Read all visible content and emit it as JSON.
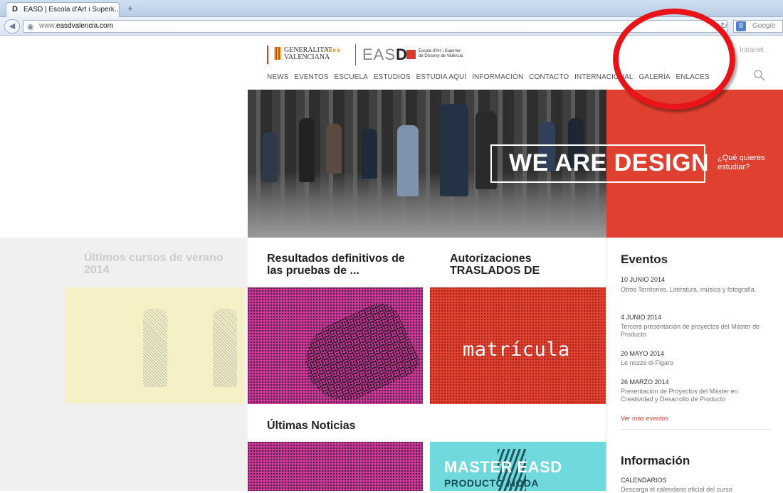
{
  "browser": {
    "tab_title": "EASD | Escola d'Art i Superi...",
    "tab_favicon": "D",
    "tab_close": "×",
    "new_tab": "+",
    "url_prefix": "www.",
    "url_domain": "easdvalencia.com",
    "search_placeholder": "Google",
    "search_engine_icon": "8"
  },
  "header": {
    "gv_logo_text": "GENERALITAT\nVALENCIANA",
    "iseacv_logo": "isea",
    "easd_logo_a": "EAS",
    "easd_logo_b": "D",
    "easd_subtitle_1": "Escola d'Art i Superior",
    "easd_subtitle_2": "de Disseny de València",
    "intranet": "Intranet",
    "nav": [
      "NEWS",
      "EVENTOS",
      "ESCUELA",
      "ESTUDIOS",
      "ESTUDIA AQUÍ",
      "INFORMACIÓN",
      "CONTACTO",
      "INTERNACIONAL",
      "GALERÍA",
      "ENLACES"
    ]
  },
  "hero": {
    "headline": "WE ARE DESIGN",
    "cta": "¿Qué quieres estudiar?"
  },
  "articles": {
    "cursos_title": "Últimos cursos de verano 2014",
    "resultados_title": "Resultados definitivos de las pruebas de ...",
    "autorizaciones_title": "Autorizaciones TRASLADOS DE",
    "matricula_word": "matrícula",
    "ultimas_noticias": "Últimas Noticias",
    "master_text": "MASTER EASD",
    "master_sub": "PRODUCTO   MODA"
  },
  "eventos": {
    "title": "Eventos",
    "items": [
      {
        "date": "10 JUNIO 2014",
        "desc": "Otros Territorios. Literatura, música y fotografía."
      },
      {
        "date": "4 JUNIO 2014",
        "desc": "Tercera presentación de proyectos del Máster de Producto"
      },
      {
        "date": "20 MAYO 2014",
        "desc": "Le nozze di Figaro"
      },
      {
        "date": "26 MARZO 2014",
        "desc": "Presentación de Proyectos del Máster en Creatividad y Desarrollo de Producto"
      }
    ],
    "ver_mas": "Ver más eventos"
  },
  "informacion": {
    "title": "Información",
    "item": "CALENDARIOS",
    "desc": "Descarga el calendario oficial del curso"
  },
  "colors": {
    "accent_red": "#e0402f",
    "annotation_circle": "#e8141a",
    "pink_tile": "#d0379a",
    "cyan_tile": "#6fd9dd"
  },
  "icons": [
    "back-arrow-icon",
    "globe-icon",
    "reload-icon",
    "google-search-icon",
    "search-magnifier-icon",
    "close-icon",
    "plus-icon"
  ]
}
